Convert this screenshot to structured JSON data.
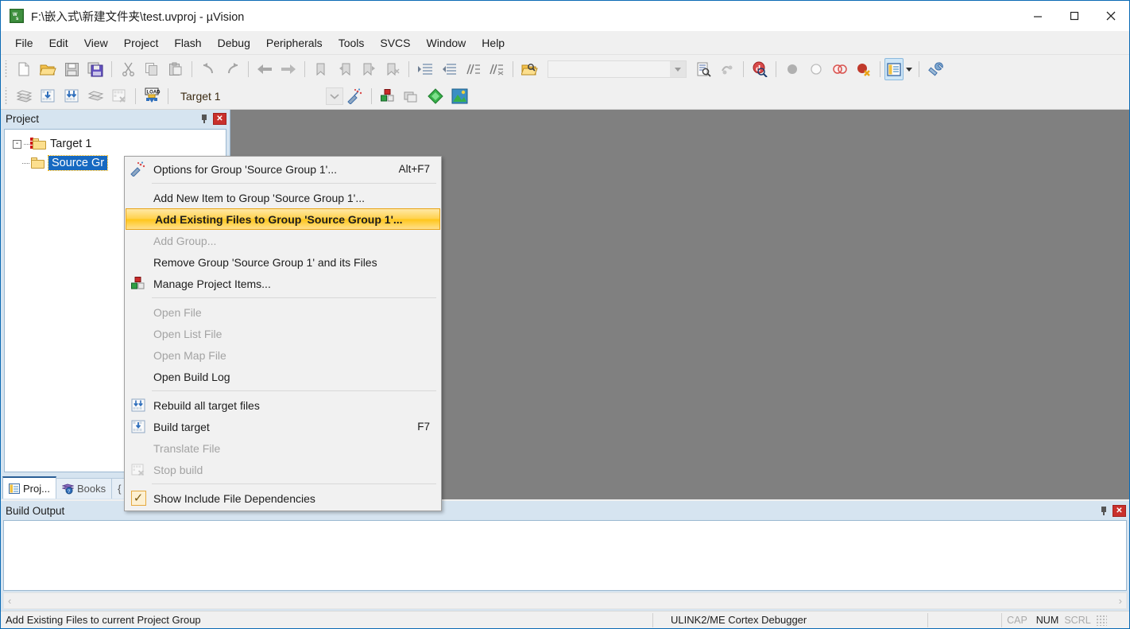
{
  "window": {
    "title": "F:\\嵌入式\\新建文件夹\\test.uvproj - µVision",
    "app_icon": "uvision-logo-icon",
    "controls": {
      "minimize": "minimize-icon",
      "maximize": "maximize-icon",
      "close": "close-icon"
    }
  },
  "menubar": {
    "items": [
      {
        "label": "File"
      },
      {
        "label": "Edit"
      },
      {
        "label": "View"
      },
      {
        "label": "Project"
      },
      {
        "label": "Flash"
      },
      {
        "label": "Debug"
      },
      {
        "label": "Peripherals"
      },
      {
        "label": "Tools"
      },
      {
        "label": "SVCS"
      },
      {
        "label": "Window"
      },
      {
        "label": "Help"
      }
    ]
  },
  "toolbar_main": {
    "buttons": [
      {
        "name": "new-file-icon",
        "label": "New"
      },
      {
        "name": "open-file-icon",
        "label": "Open"
      },
      {
        "name": "save-icon",
        "label": "Save"
      },
      {
        "name": "save-all-icon",
        "label": "Save All"
      },
      {
        "name": "cut-icon",
        "label": "Cut"
      },
      {
        "name": "copy-icon",
        "label": "Copy"
      },
      {
        "name": "paste-icon",
        "label": "Paste"
      },
      {
        "name": "undo-icon",
        "label": "Undo"
      },
      {
        "name": "redo-icon",
        "label": "Redo"
      },
      {
        "name": "navigate-back-icon",
        "label": "Back"
      },
      {
        "name": "navigate-forward-icon",
        "label": "Forward"
      },
      {
        "name": "bookmark-toggle-icon",
        "label": "Insert/Remove Bookmark"
      },
      {
        "name": "bookmark-prev-icon",
        "label": "Previous Bookmark"
      },
      {
        "name": "bookmark-next-icon",
        "label": "Next Bookmark"
      },
      {
        "name": "bookmark-clear-icon",
        "label": "Clear All Bookmarks"
      },
      {
        "name": "indent-icon",
        "label": "Indent"
      },
      {
        "name": "outdent-icon",
        "label": "Outdent"
      },
      {
        "name": "comment-icon",
        "label": "Comment Selection"
      },
      {
        "name": "uncomment-icon",
        "label": "Uncomment Selection"
      },
      {
        "name": "find-in-files-icon",
        "label": "Find in Files"
      }
    ],
    "search_combo": {
      "value": "",
      "placeholder": ""
    },
    "right_buttons": [
      {
        "name": "find-icon",
        "label": "Find"
      },
      {
        "name": "incremental-find-icon",
        "label": "Incremental Find"
      },
      {
        "name": "browse-symbol-icon",
        "label": "Browse Symbol"
      },
      {
        "name": "insert-breakpoint-icon",
        "label": "Insert/Remove Breakpoint"
      },
      {
        "name": "enable-breakpoint-icon",
        "label": "Enable/Disable Breakpoint"
      },
      {
        "name": "disable-all-breakpoints-icon",
        "label": "Disable All Breakpoints"
      },
      {
        "name": "kill-all-breakpoints-icon",
        "label": "Kill All Breakpoints"
      },
      {
        "name": "window-layout-icon",
        "label": "Configure Windows"
      },
      {
        "name": "configure-icon",
        "label": "Configuration"
      }
    ]
  },
  "toolbar_build": {
    "buttons": [
      {
        "name": "translate-file-icon",
        "label": "Translate File"
      },
      {
        "name": "build-target-icon",
        "label": "Build Target"
      },
      {
        "name": "rebuild-all-icon",
        "label": "Rebuild All Target Files"
      },
      {
        "name": "batch-build-icon",
        "label": "Batch Build"
      },
      {
        "name": "stop-build-icon",
        "label": "Stop Build"
      },
      {
        "name": "download-icon",
        "label": "Download"
      }
    ],
    "target_select": {
      "value": "Target 1",
      "name": "target-selector"
    },
    "right_buttons": [
      {
        "name": "target-options-icon",
        "label": "Options for Target"
      },
      {
        "name": "manage-project-items-icon",
        "label": "Manage Project Items"
      },
      {
        "name": "manage-multi-project-icon",
        "label": "Manage Multi-Project"
      },
      {
        "name": "pack-installer-icon",
        "label": "Pack Installer"
      },
      {
        "name": "manage-run-time-env-icon",
        "label": "Manage Run-Time Environment"
      }
    ]
  },
  "project_panel": {
    "title": "Project",
    "pin_icon": "pin-icon",
    "close_icon": "close-icon",
    "tree": [
      {
        "label": "Target 1",
        "level": 1,
        "expander": "-",
        "icon": "target-folder-icon",
        "selected": false
      },
      {
        "label": "Source Gr",
        "level": 2,
        "expander": "",
        "icon": "folder-icon",
        "selected": true
      }
    ],
    "tabs": [
      {
        "label": "Proj...",
        "icon": "project-icon",
        "active": true
      },
      {
        "label": "Books",
        "icon": "books-icon",
        "active": false
      },
      {
        "label": "{",
        "icon": "functions-icon",
        "active": false
      }
    ]
  },
  "context_menu": {
    "items": [
      {
        "label": "Options for Group 'Source Group 1'...",
        "shortcut": "Alt+F7",
        "icon": "options-wand-icon",
        "disabled": false,
        "highlight": false,
        "checkbox": false
      },
      {
        "separator": true
      },
      {
        "label": "Add New  Item to Group 'Source Group 1'...",
        "shortcut": "",
        "icon": "",
        "disabled": false,
        "highlight": false,
        "checkbox": false
      },
      {
        "label": "Add Existing Files to Group 'Source Group 1'...",
        "shortcut": "",
        "icon": "",
        "disabled": false,
        "highlight": true,
        "checkbox": false
      },
      {
        "label": "Add Group...",
        "shortcut": "",
        "icon": "",
        "disabled": true,
        "highlight": false,
        "checkbox": false
      },
      {
        "label": "Remove Group 'Source Group 1' and its Files",
        "shortcut": "",
        "icon": "",
        "disabled": false,
        "highlight": false,
        "checkbox": false
      },
      {
        "label": "Manage Project Items...",
        "shortcut": "",
        "icon": "manage-project-items-icon",
        "disabled": false,
        "highlight": false,
        "checkbox": false
      },
      {
        "separator": true
      },
      {
        "label": "Open File",
        "shortcut": "",
        "icon": "",
        "disabled": true,
        "highlight": false,
        "checkbox": false
      },
      {
        "label": "Open List File",
        "shortcut": "",
        "icon": "",
        "disabled": true,
        "highlight": false,
        "checkbox": false
      },
      {
        "label": "Open Map File",
        "shortcut": "",
        "icon": "",
        "disabled": true,
        "highlight": false,
        "checkbox": false
      },
      {
        "label": "Open Build Log",
        "shortcut": "",
        "icon": "",
        "disabled": false,
        "highlight": false,
        "checkbox": false
      },
      {
        "separator": true
      },
      {
        "label": "Rebuild all target files",
        "shortcut": "",
        "icon": "rebuild-all-icon",
        "disabled": false,
        "highlight": false,
        "checkbox": false
      },
      {
        "label": "Build target",
        "shortcut": "F7",
        "icon": "build-target-icon",
        "disabled": false,
        "highlight": false,
        "checkbox": false
      },
      {
        "label": "Translate File",
        "shortcut": "",
        "icon": "",
        "disabled": true,
        "highlight": false,
        "checkbox": false
      },
      {
        "label": "Stop build",
        "shortcut": "",
        "icon": "stop-build-icon",
        "disabled": true,
        "highlight": false,
        "checkbox": false
      },
      {
        "separator": true
      },
      {
        "label": "Show Include File Dependencies",
        "shortcut": "",
        "icon": "checkbox-checked-icon",
        "disabled": false,
        "highlight": false,
        "checkbox": true
      }
    ]
  },
  "build_output": {
    "title": "Build Output",
    "content": "",
    "pin_icon": "pin-icon",
    "close_icon": "close-icon",
    "scroll_left_icon": "chevron-left-icon",
    "scroll_right_icon": "chevron-right-icon"
  },
  "statusbar": {
    "message": "Add Existing Files to current Project Group",
    "debugger": "ULINK2/ME Cortex Debugger",
    "indicators": [
      {
        "label": "CAP",
        "active": false
      },
      {
        "label": "NUM",
        "active": true
      },
      {
        "label": "SCRL",
        "active": false
      }
    ]
  },
  "colors": {
    "accent": "#1669c1",
    "highlight": "#ffc61a",
    "panel": "#d6e4f0",
    "workspace": "#808080",
    "close_red": "#c9302c"
  }
}
